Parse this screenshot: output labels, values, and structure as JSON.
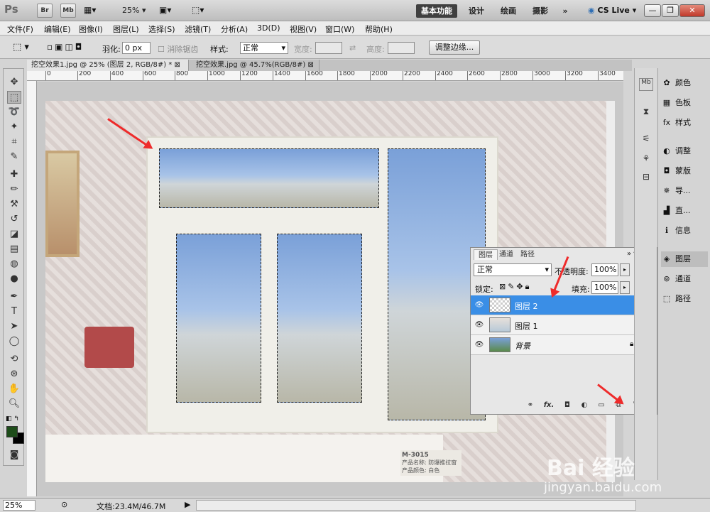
{
  "app": {
    "logo": "Ps",
    "bridge_btn": "Br",
    "minibridge_btn": "Mb",
    "zoom": "25%",
    "workspaces": [
      "基本功能",
      "设计",
      "绘画",
      "摄影"
    ],
    "more": "»",
    "cslive": "CS Live",
    "window_controls": [
      "—",
      "❐",
      "✕"
    ]
  },
  "menu": [
    "文件(F)",
    "编辑(E)",
    "图像(I)",
    "图层(L)",
    "选择(S)",
    "滤镜(T)",
    "分析(A)",
    "3D(D)",
    "视图(V)",
    "窗口(W)",
    "帮助(H)"
  ],
  "options": {
    "feather_label": "羽化:",
    "feather_value": "0 px",
    "antialias_label": "消除锯齿",
    "style_label": "样式:",
    "style_value": "正常",
    "width_label": "宽度:",
    "height_label": "高度:",
    "refine_edge": "调整边缘..."
  },
  "tabs": [
    {
      "title": "挖空效果1.jpg @ 25% (图层 2, RGB/8#) *",
      "active": true
    },
    {
      "title": "挖空效果.jpg @ 45.7%(RGB/8#)",
      "active": false
    }
  ],
  "ruler_ticks": [
    "0",
    "200",
    "400",
    "600",
    "800",
    "1000",
    "1200",
    "1400",
    "1600",
    "1800",
    "2000",
    "2200",
    "2400",
    "2600",
    "2800",
    "3000",
    "3200",
    "3400"
  ],
  "image": {
    "card_line1": "M-3015",
    "card_line2": "产品名称: 防爆推拉窗",
    "card_line3": "产品颜色: 白色"
  },
  "layers_panel": {
    "tabs": [
      "图层",
      "通道",
      "路径"
    ],
    "blend_mode": "正常",
    "opacity_label": "不透明度:",
    "opacity_value": "100%",
    "lock_label": "锁定:",
    "fill_label": "填充:",
    "fill_value": "100%",
    "layers": [
      {
        "name": "图层 2",
        "selected": true
      },
      {
        "name": "图层 1",
        "selected": false
      },
      {
        "name": "背景",
        "selected": false,
        "locked": true
      }
    ],
    "footer_icons": [
      "link-icon",
      "fx-icon",
      "mask-icon",
      "adjustment-icon",
      "group-icon",
      "new-layer-icon",
      "trash-icon"
    ],
    "fx_label": "fx."
  },
  "dock": {
    "items": [
      {
        "label": "颜色",
        "icon": "color-icon"
      },
      {
        "label": "色板",
        "icon": "swatches-icon"
      },
      {
        "label": "样式",
        "icon": "styles-icon"
      },
      {
        "label": "调整",
        "icon": "adjustments-icon"
      },
      {
        "label": "蒙版",
        "icon": "masks-icon"
      },
      {
        "label": "导...",
        "icon": "navigator-icon"
      },
      {
        "label": "直...",
        "icon": "histogram-icon"
      },
      {
        "label": "信息",
        "icon": "info-icon"
      },
      {
        "label": "图层",
        "icon": "layers-icon"
      },
      {
        "label": "通道",
        "icon": "channels-icon"
      },
      {
        "label": "路径",
        "icon": "paths-icon"
      }
    ]
  },
  "status": {
    "zoom": "25%",
    "doc": "文档:23.4M/46.7M"
  },
  "watermark": {
    "brand": "Bai 经验",
    "url": "jingyan.baidu.com"
  },
  "colors": {
    "foreground": "#1e4d1a",
    "background": "#000000",
    "selection_blue": "#3a8ee6",
    "arrow_red": "#ee2b2b"
  }
}
